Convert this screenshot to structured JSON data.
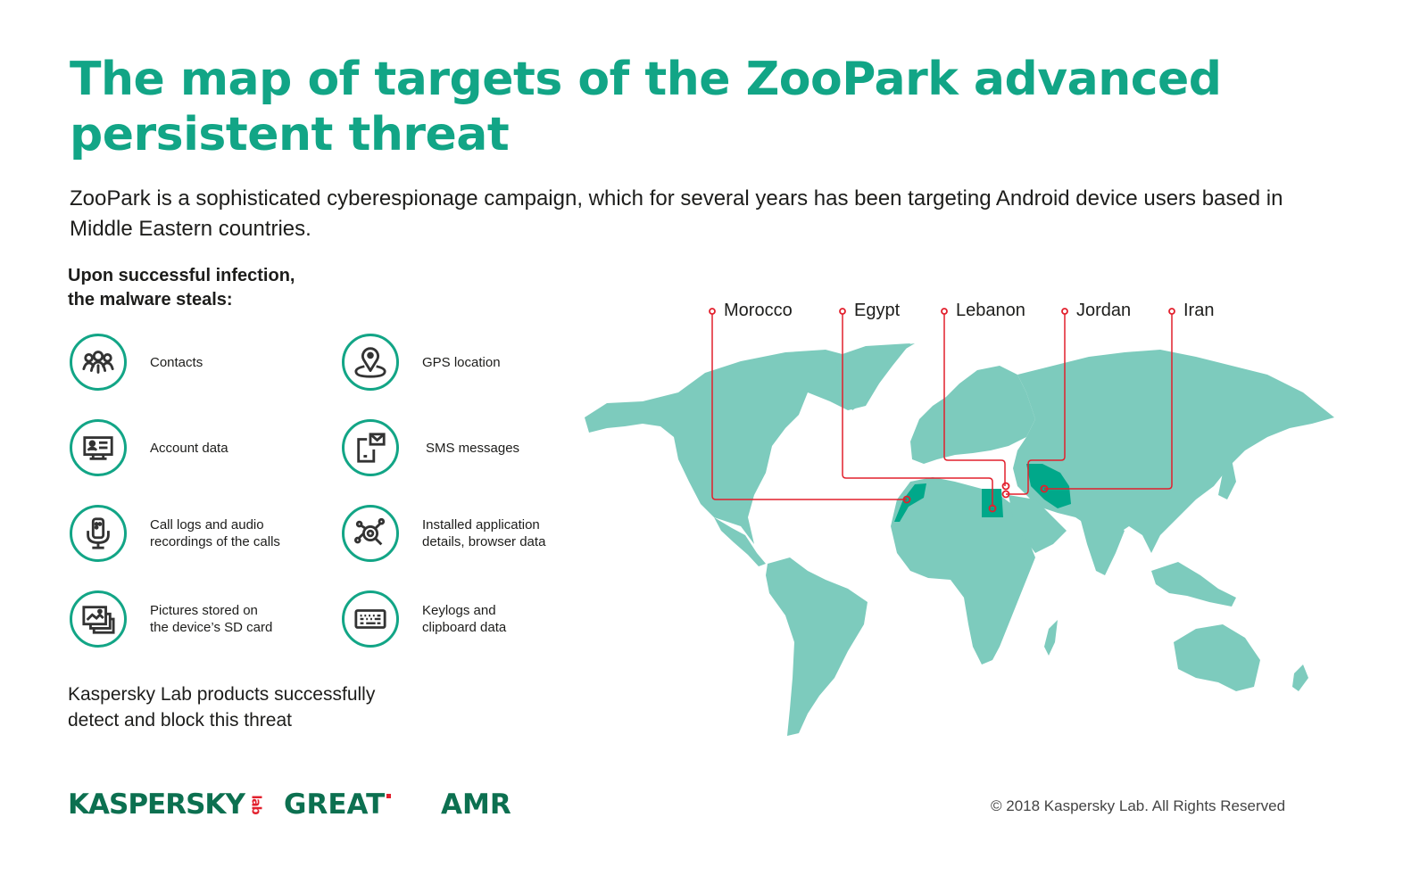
{
  "header": {
    "title": "The map of targets of the ZooPark advanced persistent threat",
    "intro": "ZooPark is a sophisticated cyberespionage campaign, which for several years has been targeting Android device users based in Middle Eastern countries."
  },
  "steals": {
    "heading_line1": "Upon successful infection,",
    "heading_line2": "the malware steals:",
    "items": [
      {
        "icon": "contacts-icon",
        "label": "Contacts"
      },
      {
        "icon": "gps-location-icon",
        "label": "GPS location"
      },
      {
        "icon": "account-data-icon",
        "label": "Account data"
      },
      {
        "icon": "sms-messages-icon",
        "label": "SMS messages"
      },
      {
        "icon": "microphone-icon",
        "label": "Call logs and audio\nrecordings of the calls"
      },
      {
        "icon": "app-analysis-icon",
        "label": "Installed application\ndetails, browser data"
      },
      {
        "icon": "pictures-icon",
        "label": "Pictures stored on\nthe device’s SD card"
      },
      {
        "icon": "keyboard-icon",
        "label": "Keylogs and\nclipboard data"
      }
    ]
  },
  "detect_note": "Kaspersky Lab products successfully\ndetect and block this threat",
  "map": {
    "land_color": "#7dcbbd",
    "target_color": "#00a88a",
    "line_color": "#e2202d",
    "targets": [
      "Morocco",
      "Egypt",
      "Lebanon",
      "Jordan",
      "Iran"
    ]
  },
  "footer": {
    "logo_kaspersky": "KASPERSKY",
    "logo_kaspersky_lab": "lab",
    "logo_great": "GREAT",
    "logo_amr": "AMR",
    "copyright": "© 2018  Kaspersky Lab. All Rights Reserved"
  }
}
